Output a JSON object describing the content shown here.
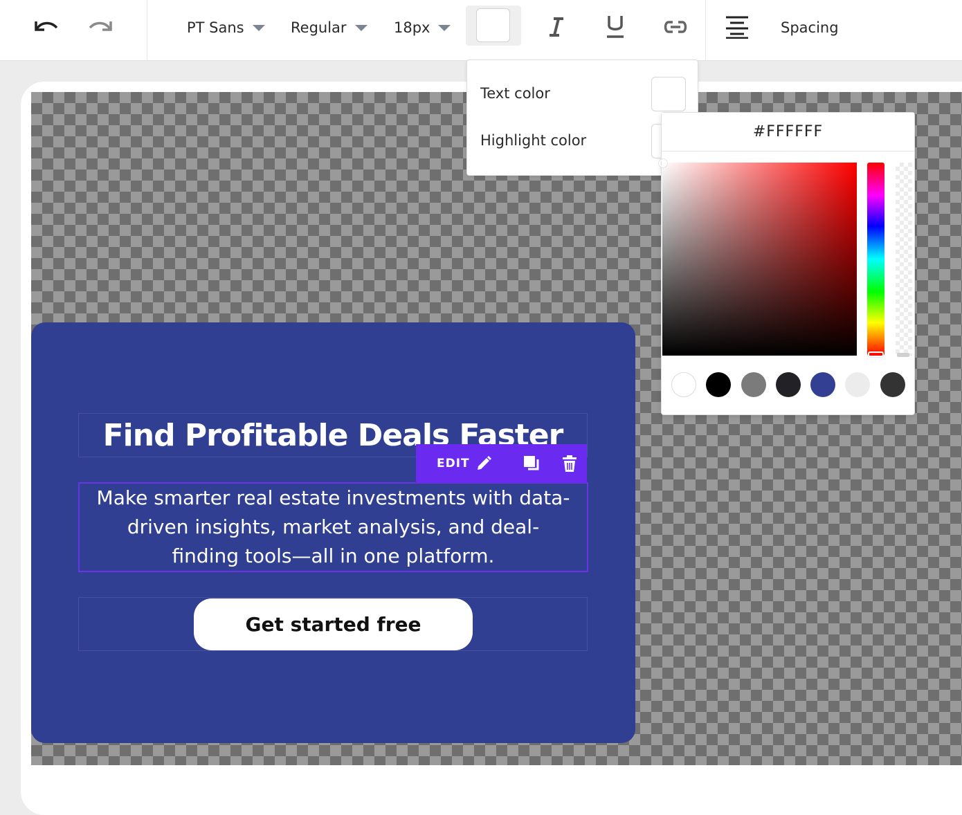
{
  "toolbar": {
    "font_family": "PT Sans",
    "font_weight": "Regular",
    "font_size": "18px",
    "current_color": "#FFFFFF",
    "spacing_label": "Spacing"
  },
  "color_menu": {
    "text_color_label": "Text color",
    "highlight_color_label": "Highlight color"
  },
  "color_picker": {
    "hex_value": "#FFFFFF",
    "presets": [
      "#ffffff",
      "#000000",
      "#7b7b7b",
      "#222226",
      "#323f93",
      "#ececec",
      "#333333"
    ]
  },
  "hero": {
    "headline": "Find Profitable Deals Faster",
    "subtext": "Make smarter real estate investments with data-driven insights, market analysis, and deal-finding tools—all in one platform.",
    "cta_label": "Get started free",
    "background": "#313f93"
  },
  "edit_bar": {
    "edit_label": "EDIT",
    "accent": "#6a2af0"
  }
}
